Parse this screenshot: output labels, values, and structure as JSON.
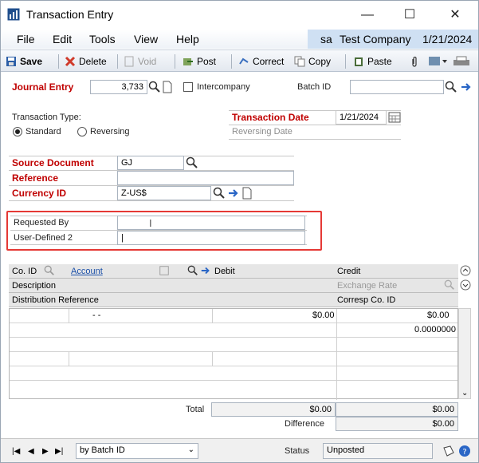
{
  "window": {
    "title": "Transaction Entry",
    "min_glyph": "—",
    "max_glyph": "☐",
    "close_glyph": "✕"
  },
  "menu": [
    "File",
    "Edit",
    "Tools",
    "View",
    "Help"
  ],
  "company": {
    "user": "sa",
    "name": "Test Company",
    "date": "1/21/2024"
  },
  "toolbar": {
    "save": "Save",
    "delete": "Delete",
    "void": "Void",
    "post": "Post",
    "correct": "Correct",
    "copy": "Copy",
    "paste": "Paste"
  },
  "form": {
    "journal_entry_label": "Journal Entry",
    "journal_entry_value": "3,733",
    "intercompany_label": "Intercompany",
    "batch_id_label": "Batch ID",
    "batch_id_value": "",
    "transaction_type_label": "Transaction Type:",
    "standard_label": "Standard",
    "reversing_label": "Reversing",
    "transaction_date_label": "Transaction Date",
    "transaction_date_value": "1/21/2024",
    "reversing_date_label": "Reversing Date",
    "source_document_label": "Source Document",
    "source_document_value": "GJ",
    "reference_label": "Reference",
    "reference_value": "",
    "currency_id_label": "Currency ID",
    "currency_id_value": "Z-US$",
    "requested_by_label": "Requested By",
    "requested_by_value": "",
    "user_defined2_label": "User-Defined 2",
    "user_defined2_value": "|"
  },
  "grid": {
    "col_coid": "Co. ID",
    "col_account": "Account",
    "col_debit": "Debit",
    "col_credit": "Credit",
    "col_description": "Description",
    "col_exchange_rate": "Exchange Rate",
    "col_dist_ref": "Distribution Reference",
    "col_corresp": "Corresp Co. ID",
    "row1_account": "-       -",
    "row1_debit": "$0.00",
    "row1_credit": "$0.00",
    "row2_rate": "0.0000000"
  },
  "totals": {
    "total_label": "Total",
    "total_debit": "$0.00",
    "total_credit": "$0.00",
    "difference_label": "Difference",
    "difference_value": "$0.00"
  },
  "statusbar": {
    "sort_value": "by Batch ID",
    "status_label": "Status",
    "status_value": "Unposted"
  },
  "colors": {
    "required_red": "#c00000",
    "highlight_box": "#e53935",
    "company_band": "#cfe0f3"
  }
}
